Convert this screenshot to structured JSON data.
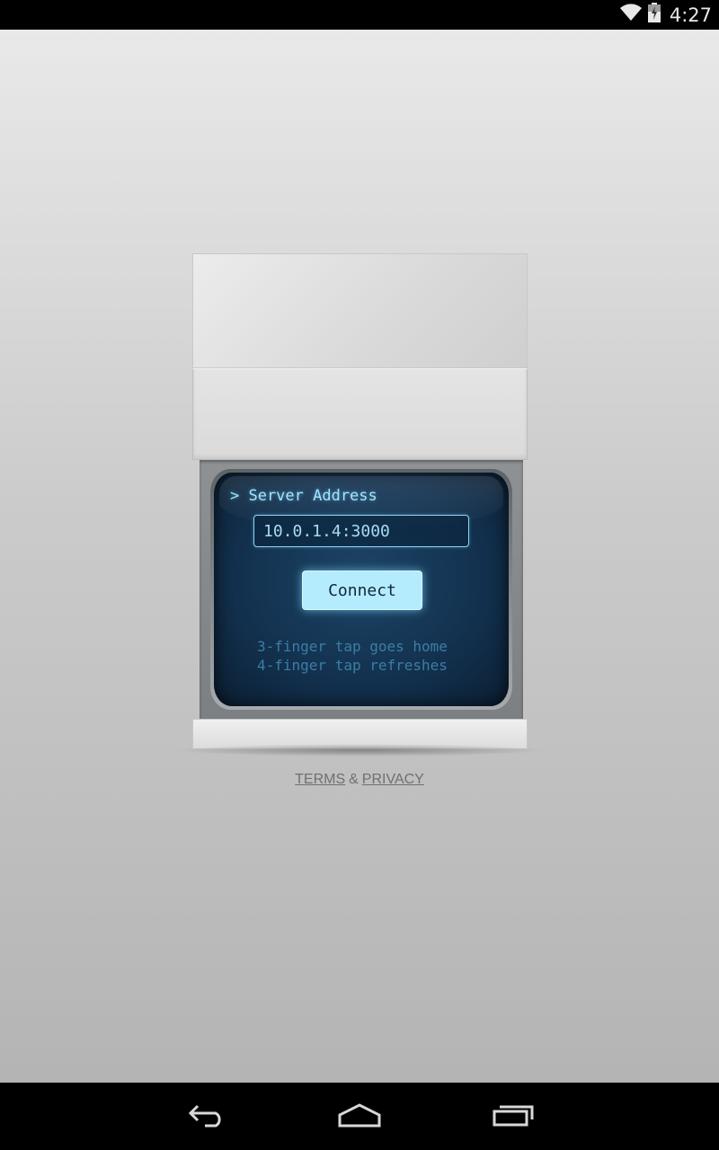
{
  "status_bar": {
    "time": "4:27",
    "icons": [
      "wifi-icon",
      "battery-icon"
    ]
  },
  "screen": {
    "prompt_label": "> Server Address",
    "server_address_value": "10.0.1.4:3000",
    "connect_label": "Connect",
    "hint_line_1": "3-finger tap goes home",
    "hint_line_2": "4-finger tap refreshes"
  },
  "footer_links": {
    "terms": "TERMS",
    "separator": "&",
    "privacy": "PRIVACY"
  },
  "nav_bar": {
    "icons": [
      "back-icon",
      "home-icon",
      "recent-apps-icon"
    ]
  },
  "colors": {
    "screen_text": "#9fe6ff",
    "button_fill": "#b5ecfd",
    "hint_text": "#3b7ea3",
    "link_text": "#6f6f6f"
  }
}
